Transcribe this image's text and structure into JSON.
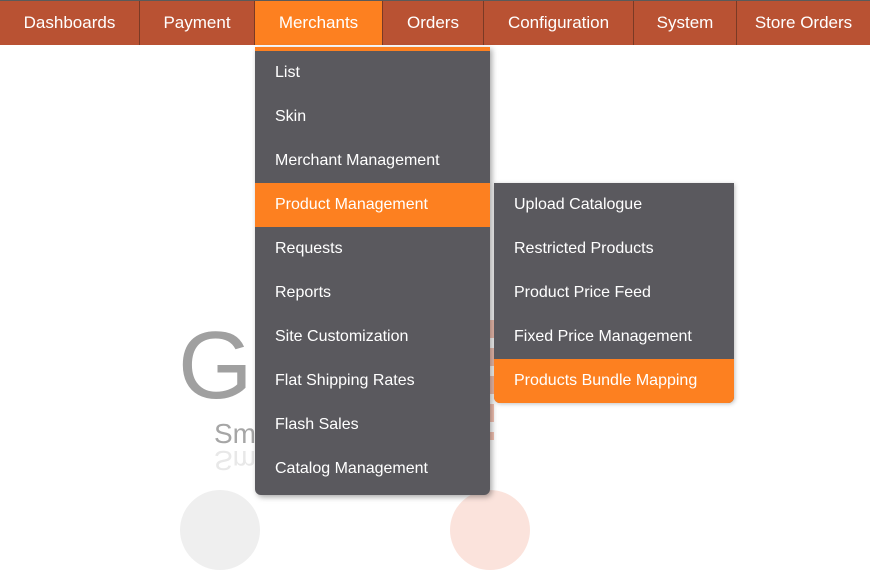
{
  "nav": {
    "items": [
      {
        "label": "Dashboards",
        "active": false
      },
      {
        "label": "Payment",
        "active": false
      },
      {
        "label": "Merchants",
        "active": true
      },
      {
        "label": "Orders",
        "active": false
      },
      {
        "label": "Configuration",
        "active": false
      },
      {
        "label": "System",
        "active": false
      },
      {
        "label": "Store Orders",
        "active": false
      }
    ]
  },
  "merchants_menu": {
    "items": [
      {
        "label": "List"
      },
      {
        "label": "Skin"
      },
      {
        "label": "Merchant Management"
      },
      {
        "label": "Product Management",
        "active": true
      },
      {
        "label": "Requests"
      },
      {
        "label": "Reports"
      },
      {
        "label": "Site Customization"
      },
      {
        "label": "Flat Shipping Rates"
      },
      {
        "label": "Flash Sales"
      },
      {
        "label": "Catalog Management"
      }
    ]
  },
  "product_management_submenu": {
    "items": [
      {
        "label": "Upload Catalogue"
      },
      {
        "label": "Restricted Products"
      },
      {
        "label": "Product Price Feed"
      },
      {
        "label": "Fixed Price Management"
      },
      {
        "label": "Products Bundle Mapping",
        "active": true
      }
    ]
  },
  "background_logo": {
    "letter": "G",
    "tagline_fragment": "Sm"
  },
  "colors": {
    "nav_bg": "#b95233",
    "accent": "#fd8020",
    "menu_bg": "#5a595e"
  }
}
